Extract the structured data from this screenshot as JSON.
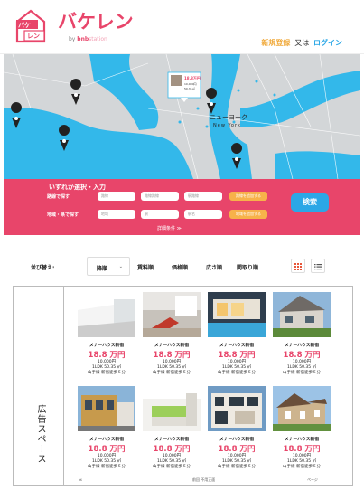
{
  "header": {
    "logo_text": "バケレン",
    "logo_icon_text_top": "バケ",
    "logo_icon_text_bottom": "レン",
    "sub_by": "by",
    "sub_brand": "bnb",
    "sub_brand_tail": "station",
    "register_label": "新規登録",
    "or_label": "又は",
    "login_label": "ログイン",
    "brand_color": "#e8456a"
  },
  "map": {
    "city_label": "ニューヨーク",
    "city_label_en": "New York",
    "popup_price": "18.8万円",
    "popup_line1": "10,000円",
    "popup_line2": "50.35㎡",
    "water_color": "#33b8ea",
    "land_color": "#cfd3d6"
  },
  "search": {
    "title": "いずれか選択・入力",
    "row1_label": "路線で探す",
    "row1_fields": [
      "路線",
      "路線路線",
      "駅路線",
      "駅路線"
    ],
    "row1_cond": "路線を追加する",
    "row2_label": "地域・県で探す",
    "row2_fields": [
      "地域",
      "駅",
      "駅名"
    ],
    "row2_cond": "地域を追加する",
    "search_button": "検索",
    "more_conditions": "詳細条件 ≫"
  },
  "sort": {
    "label": "並び替え:",
    "active": "降順",
    "options": [
      "賃料順",
      "価格順",
      "広さ順",
      "間取り順"
    ]
  },
  "ad_label": "広告スペース",
  "cards": [
    {
      "name": "メナーハウス新宿",
      "price": "18.8 万円",
      "line1": "10,000円",
      "line2": "1LDK 50.35 ㎡",
      "line3": "山手線 新宿徒歩５分"
    },
    {
      "name": "メナーハウス新宿",
      "price": "18.8 万円",
      "line1": "10,000円",
      "line2": "1LDK 50.35 ㎡",
      "line3": "山手線 新宿徒歩５分"
    },
    {
      "name": "メナーハウス新宿",
      "price": "18.8 万円",
      "line1": "10,000円",
      "line2": "1LDK 50.35 ㎡",
      "line3": "山手線 新宿徒歩５分"
    },
    {
      "name": "メナーハウス新宿",
      "price": "18.8 万円",
      "line1": "10,000円",
      "line2": "1LDK 50.35 ㎡",
      "line3": "山手線 新宿徒歩５分"
    },
    {
      "name": "メナーハウス新宿",
      "price": "18.8 万円",
      "line1": "10,000円",
      "line2": "1LDK 50.35 ㎡",
      "line3": "山手線 新宿徒歩５分"
    },
    {
      "name": "メナーハウス新宿",
      "price": "18.8 万円",
      "line1": "10,000円",
      "line2": "1LDK 50.35 ㎡",
      "line3": "山手線 新宿徒歩５分"
    },
    {
      "name": "メナーハウス新宿",
      "price": "18.8 万円",
      "line1": "10,000円",
      "line2": "1LDK 50.35 ㎡",
      "line3": "山手線 新宿徒歩５分"
    },
    {
      "name": "メナーハウス新宿",
      "price": "18.8 万円",
      "line1": "10,000円",
      "line2": "1LDK 50.35 ㎡",
      "line3": "山手線 新宿徒歩５分"
    }
  ],
  "pager": {
    "prev": "≪",
    "center": "前回 不用正面",
    "next": "ページ"
  }
}
